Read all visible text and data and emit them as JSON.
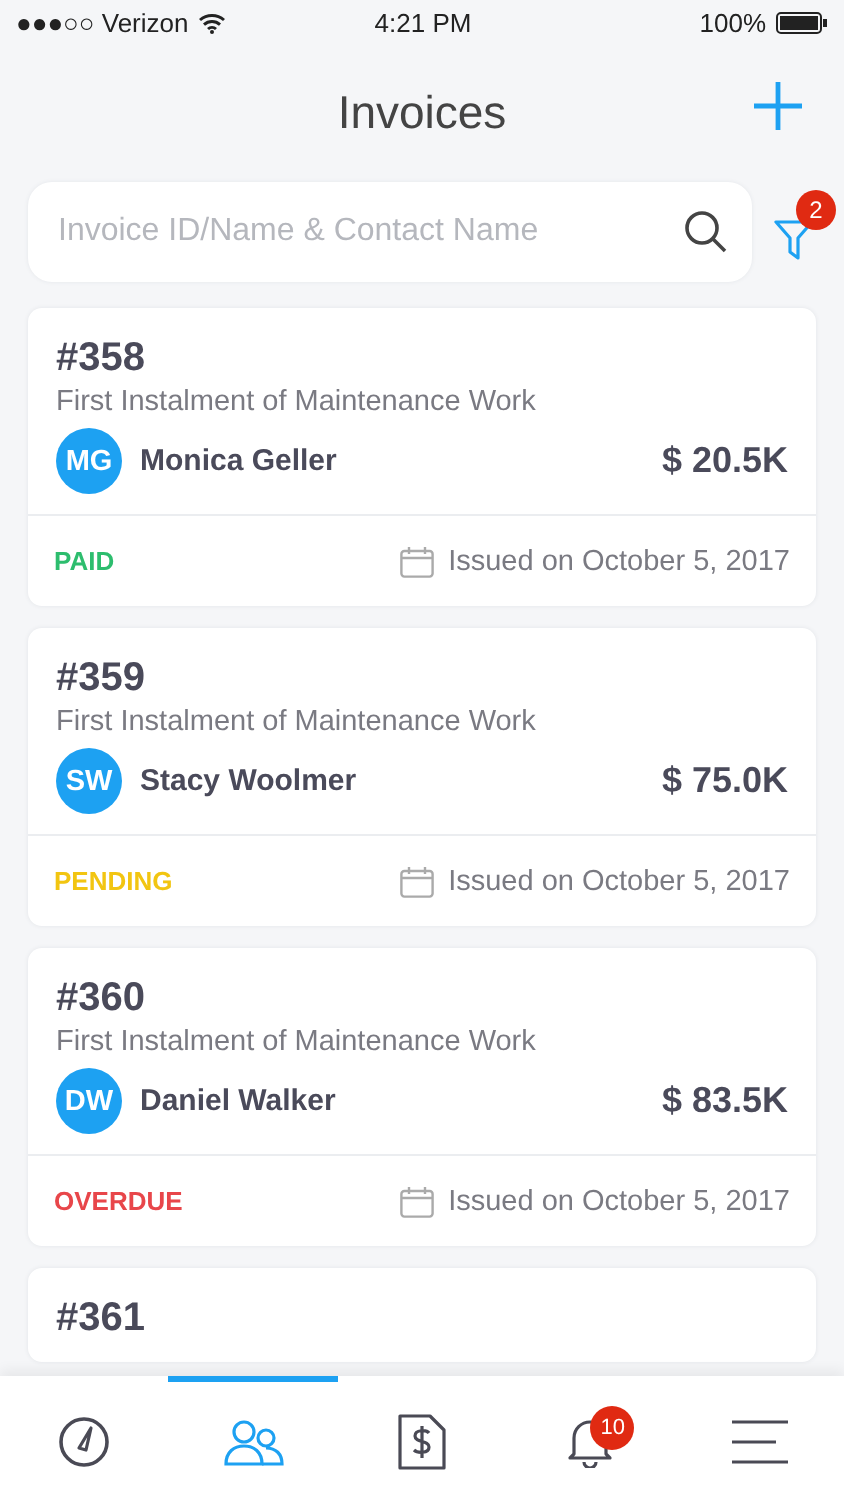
{
  "status_bar": {
    "carrier": "●●●○○ Verizon",
    "time": "4:21 PM",
    "battery": "100%"
  },
  "header": {
    "title": "Invoices"
  },
  "search": {
    "placeholder": "Invoice ID/Name & Contact Name"
  },
  "filter": {
    "badge": "2"
  },
  "invoices": [
    {
      "number": "#358",
      "description": "First Instalment of Maintenance Work",
      "initials": "MG",
      "contact": "Monica Geller",
      "amount": "$ 20.5K",
      "status": "PAID",
      "color": "#2dbd6e",
      "issued": "Issued on October 5, 2017"
    },
    {
      "number": "#359",
      "description": "First Instalment of Maintenance Work",
      "initials": "SW",
      "contact": "Stacy Woolmer",
      "amount": "$ 75.0K",
      "status": "PENDING",
      "color": "#f2c511",
      "issued": "Issued on October 5, 2017"
    },
    {
      "number": "#360",
      "description": "First Instalment of Maintenance Work",
      "initials": "DW",
      "contact": "Daniel Walker",
      "amount": "$ 83.5K",
      "status": "OVERDUE",
      "color": "#e8464a",
      "issued": "Issued on October 5, 2017"
    },
    {
      "number": "#361"
    }
  ],
  "tab_bar": [
    {
      "kind": "dashboard",
      "selected": false
    },
    {
      "kind": "contacts",
      "selected": true
    },
    {
      "kind": "invoice",
      "selected": false
    },
    {
      "kind": "notifications",
      "selected": false,
      "badge": "10"
    },
    {
      "kind": "menu",
      "selected": false
    }
  ]
}
